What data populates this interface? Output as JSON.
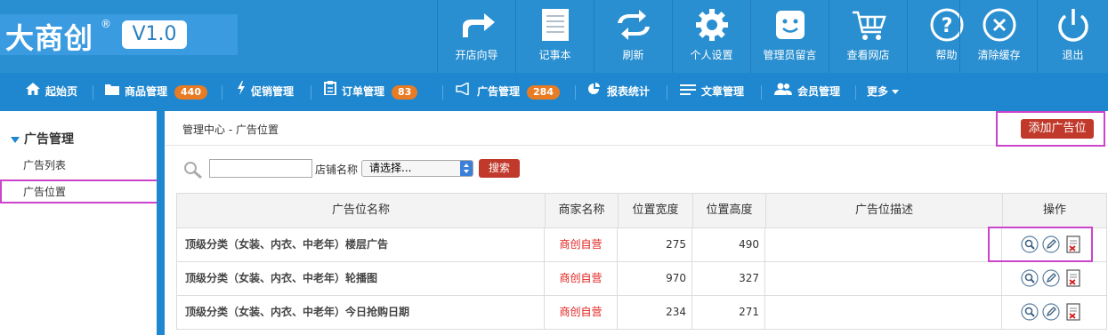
{
  "brand": {
    "logo_text": "大商创",
    "reg_mark": "®",
    "version": "V1.0"
  },
  "toolbar": [
    {
      "label": "开店向导",
      "icon": "share-arrow-icon"
    },
    {
      "label": "记事本",
      "icon": "notepad-icon"
    },
    {
      "label": "刷新",
      "icon": "refresh-icon"
    },
    {
      "label": "个人设置",
      "icon": "gear-icon"
    },
    {
      "label": "管理员留言",
      "icon": "smiley-message-icon"
    },
    {
      "label": "查看网店",
      "icon": "cart-icon"
    },
    {
      "label": "帮助",
      "icon": "help-icon"
    },
    {
      "label": "清除缓存",
      "icon": "clear-icon"
    },
    {
      "label": "退出",
      "icon": "power-icon"
    }
  ],
  "nav": [
    {
      "label": "起始页",
      "icon": "home-icon"
    },
    {
      "label": "商品管理",
      "icon": "folder-icon",
      "badge": "440"
    },
    {
      "label": "促销管理",
      "icon": "lightning-icon"
    },
    {
      "label": "订单管理",
      "icon": "clipboard-icon",
      "badge": "83"
    },
    {
      "label": "广告管理",
      "icon": "megaphone-icon",
      "badge": "284"
    },
    {
      "label": "报表统计",
      "icon": "pie-chart-icon"
    },
    {
      "label": "文章管理",
      "icon": "list-icon"
    },
    {
      "label": "会员管理",
      "icon": "users-icon"
    },
    {
      "label": "更多",
      "icon": "caret-down-icon"
    }
  ],
  "sidebar": {
    "title": "广告管理",
    "items": [
      {
        "label": "广告列表"
      },
      {
        "label": "广告位置"
      }
    ]
  },
  "main": {
    "breadcrumb": "管理中心  - 广告位置",
    "add_button": "添加广告位",
    "search": {
      "input_value": "",
      "shop_label": "店铺名称",
      "select_value": "请选择...",
      "button": "搜索"
    },
    "table": {
      "headers": [
        "广告位名称",
        "商家名称",
        "位置宽度",
        "位置高度",
        "广告位描述",
        "操作"
      ],
      "rows": [
        {
          "name": "顶级分类（女装、内衣、中老年）楼层广告",
          "shop": "商创自营",
          "width": "275",
          "height": "490",
          "desc": ""
        },
        {
          "name": "顶级分类（女装、内衣、中老年）轮播图",
          "shop": "商创自营",
          "width": "970",
          "height": "327",
          "desc": ""
        },
        {
          "name": "顶级分类（女装、内衣、中老年）今日抢购日期",
          "shop": "商创自营",
          "width": "234",
          "height": "271",
          "desc": ""
        }
      ]
    }
  },
  "colors": {
    "header": "#2a8fd0",
    "nav": "#1e87cf",
    "danger": "#c0392b",
    "shop": "#e0201c",
    "badge": "#e87c24",
    "highlight": "#cc44cc"
  }
}
